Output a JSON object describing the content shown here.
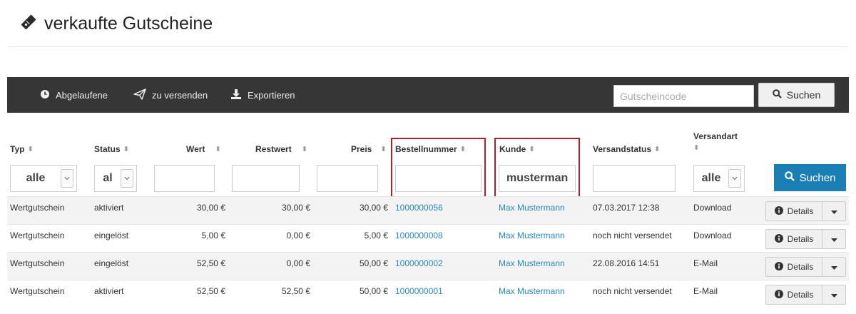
{
  "page": {
    "title": "verkaufte Gutscheine"
  },
  "toolbar": {
    "expired_label": "Abgelaufene",
    "to_send_label": "zu versenden",
    "export_label": "Exportieren",
    "search_placeholder": "Gutscheincode",
    "search_label": "Suchen"
  },
  "columns": {
    "typ": "Typ",
    "status": "Status",
    "wert": "Wert",
    "restwert": "Restwert",
    "preis": "Preis",
    "bestellnummer": "Bestellnummer",
    "kunde": "Kunde",
    "versandstatus": "Versandstatus",
    "versandart": "Versandart"
  },
  "filters": {
    "typ": "alle",
    "status": "al",
    "kunde": "mustermann",
    "versandart": "alle",
    "search_label": "Suchen"
  },
  "rows": [
    {
      "typ": "Wertgutschein",
      "status": "aktiviert",
      "wert": "30,00 €",
      "restwert": "30,00 €",
      "preis": "30,00 €",
      "bestellnummer": "1000000056",
      "kunde": "Max Mustermann",
      "versandstatus": "07.03.2017 12:38",
      "versandart": "Download",
      "details": "Details"
    },
    {
      "typ": "Wertgutschein",
      "status": "eingelöst",
      "wert": "5,00 €",
      "restwert": "0,00 €",
      "preis": "5,00 €",
      "bestellnummer": "1000000008",
      "kunde": "Max Mustermann",
      "versandstatus": "noch nicht versendet",
      "versandart": "Download",
      "details": "Details"
    },
    {
      "typ": "Wertgutschein",
      "status": "eingelöst",
      "wert": "52,50 €",
      "restwert": "0,00 €",
      "preis": "50,00 €",
      "bestellnummer": "1000000002",
      "kunde": "Max Mustermann",
      "versandstatus": "22.08.2016 14:51",
      "versandart": "E-Mail",
      "details": "Details"
    },
    {
      "typ": "Wertgutschein",
      "status": "aktiviert",
      "wert": "52,50 €",
      "restwert": "52,50 €",
      "preis": "50,00 €",
      "bestellnummer": "1000000001",
      "kunde": "Max Mustermann",
      "versandstatus": "noch nicht versendet",
      "versandart": "E-Mail",
      "details": "Details"
    }
  ],
  "icons": {
    "title": "ticket-icon",
    "expired": "clock-icon",
    "to_send": "paper-plane-icon",
    "export": "download-icon",
    "search": "search-icon",
    "details": "info-icon",
    "dropdown": "caret-down-icon"
  },
  "colors": {
    "toolbar": "#363636",
    "link": "#2a88bd",
    "primary_button": "#1a7fb5",
    "highlight_box": "#b41e2a"
  }
}
